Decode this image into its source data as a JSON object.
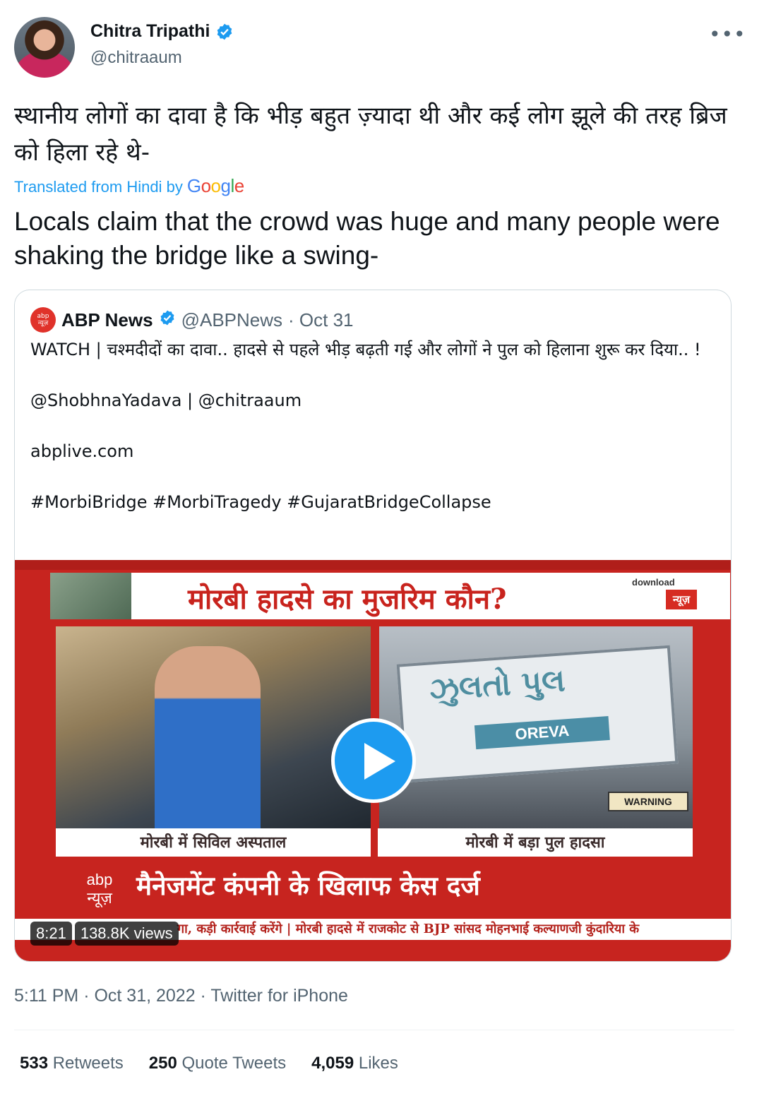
{
  "author": {
    "name": "Chitra Tripathi",
    "handle": "@chitraaum"
  },
  "tweet": {
    "text_hindi": "स्थानीय लोगों का दावा है कि भीड़ बहुत ज़्यादा थी और कई लोग झूले की तरह ब्रिज को हिला रहे थे-",
    "translated_label": "Translated from Hindi by",
    "translator": "Google",
    "text_english": "Locals claim that the crowd was huge and many people were shaking the bridge like a swing-"
  },
  "quote": {
    "name": "ABP News",
    "handle": "@ABPNews",
    "date": "· Oct 31",
    "logo_line1": "abp",
    "logo_line2": "न्यूज़",
    "text": "WATCH | चश्मदीदों का दावा.. हादसे से पहले भीड़ बढ़ती गई और लोगों ने पुल को हिलाना शुरू कर दिया.. !\n\n@ShobhnaYadava | @chitraaum\n\nabplive.com\n\n#MorbiBridge #MorbiTragedy #GujaratBridgeCollapse",
    "video": {
      "title": "मोरबी हादसे का मुजरिम कौन?",
      "download": "download",
      "news_tag": "न्यूज़",
      "caption_left": "मोरबी में सिविल अस्पताल",
      "caption_right": "मोरबी में बड़ा पुल हादसा",
      "sign_text": "ઝુલતો પુલ",
      "sign_brand": "OREVA",
      "warning": "WARNING",
      "brand_line1": "abp",
      "brand_line2": "न्यूज़",
      "headline": "मैनेजमेंट कंपनी के खिलाफ केस दर्ज",
      "ticker": "गा, कड़ी कार्रवाई करेंगे   |   मोरबी हादसे में राजकोट से BJP सांसद मोहनभाई कल्याणजी कुंदारिया के",
      "duration": "8:21",
      "views": "138.8K views"
    }
  },
  "meta": {
    "timestamp": "5:11 PM · Oct 31, 2022 · Twitter for iPhone"
  },
  "stats": {
    "retweets_count": "533",
    "retweets_label": "Retweets",
    "quotes_count": "250",
    "quotes_label": "Quote Tweets",
    "likes_count": "4,059",
    "likes_label": "Likes"
  },
  "colors": {
    "link": "#1d9bf0",
    "secondary_text": "#536471",
    "abp_red": "#c7241f"
  }
}
